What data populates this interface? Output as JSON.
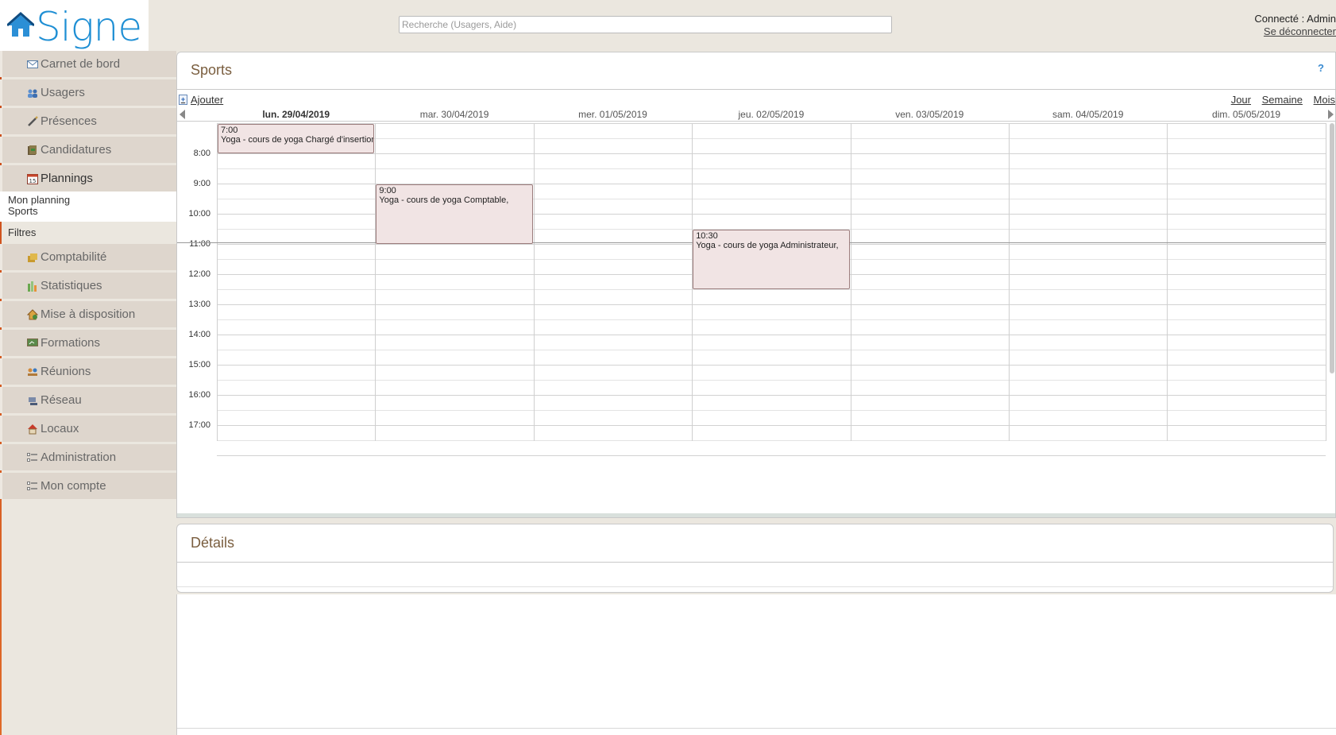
{
  "header": {
    "logo_text": "Signe",
    "search_placeholder": "Recherche (Usagers, Aide)",
    "connected_label": "Connecté : Admin",
    "logout_label": "Se déconnecter"
  },
  "sidebar": {
    "items": [
      {
        "label": "Carnet de bord",
        "icon": "envelope-icon"
      },
      {
        "label": "Usagers",
        "icon": "users-icon"
      },
      {
        "label": "Présences",
        "icon": "pen-icon"
      },
      {
        "label": "Candidatures",
        "icon": "folder-icon"
      },
      {
        "label": "Plannings",
        "icon": "calendar-icon"
      },
      {
        "label": "Comptabilité",
        "icon": "coins-icon"
      },
      {
        "label": "Statistiques",
        "icon": "bar-chart-icon"
      },
      {
        "label": "Mise à disposition",
        "icon": "house-icon"
      },
      {
        "label": "Formations",
        "icon": "board-icon"
      },
      {
        "label": "Réunions",
        "icon": "meeting-icon"
      },
      {
        "label": "Réseau",
        "icon": "network-icon"
      },
      {
        "label": "Locaux",
        "icon": "building-icon"
      },
      {
        "label": "Administration",
        "icon": "list-icon"
      },
      {
        "label": "Mon compte",
        "icon": "list-icon"
      }
    ],
    "plannings_sub": [
      "Mon planning",
      "Sports"
    ],
    "filters_label": "Filtres"
  },
  "panel": {
    "title": "Sports",
    "help": "?",
    "add_label": "Ajouter",
    "views": [
      "Jour",
      "Semaine",
      "Mois"
    ]
  },
  "calendar": {
    "days": [
      "lun. 29/04/2019",
      "mar. 30/04/2019",
      "mer. 01/05/2019",
      "jeu. 02/05/2019",
      "ven. 03/05/2019",
      "sam. 04/05/2019",
      "dim. 05/05/2019"
    ],
    "today_index": 0,
    "hours": [
      "8:00",
      "9:00",
      "10:00",
      "11:00",
      "12:00",
      "13:00",
      "14:00",
      "15:00",
      "16:00",
      "17:00"
    ],
    "first_hour": 7,
    "events": [
      {
        "day": 0,
        "start": 7.0,
        "end": 8.0,
        "time": "7:00",
        "title": "Yoga - cours de yoga Chargé d'insertion,"
      },
      {
        "day": 1,
        "start": 9.0,
        "end": 11.0,
        "time": "9:00",
        "title": "Yoga - cours de yoga Comptable,"
      },
      {
        "day": 3,
        "start": 10.5,
        "end": 12.5,
        "time": "10:30",
        "title": "Yoga - cours de yoga Administrateur,"
      }
    ],
    "now_hour": 10.95
  },
  "details": {
    "title": "Détails"
  }
}
